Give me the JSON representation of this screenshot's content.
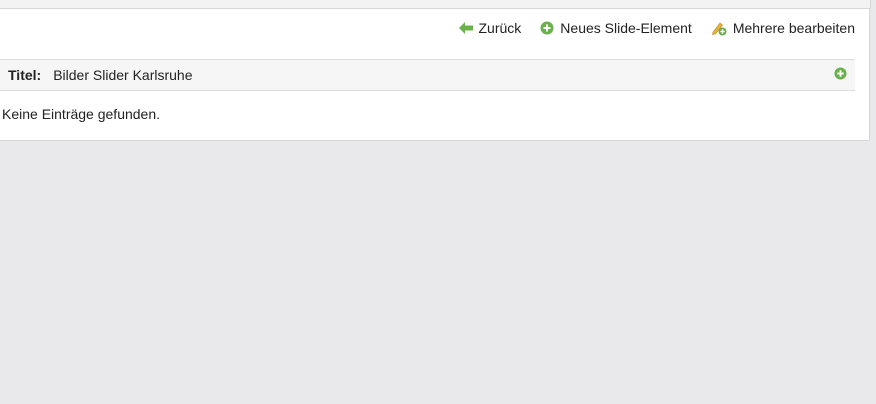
{
  "toolbar": {
    "back_label": "Zurück",
    "new_slide_label": "Neues Slide-Element",
    "edit_multiple_label": "Mehrere bearbeiten"
  },
  "title_row": {
    "label": "Titel:",
    "value": "Bilder Slider Karlsruhe"
  },
  "empty_message": "Keine Einträge gefunden.",
  "colors": {
    "accent_green": "#6ab04c",
    "page_bg": "#e9e9eb"
  },
  "icons": {
    "back": "arrow-left-icon",
    "new": "plus-circle-icon",
    "edit": "pencil-plus-icon",
    "add_title": "plus-circle-icon"
  }
}
